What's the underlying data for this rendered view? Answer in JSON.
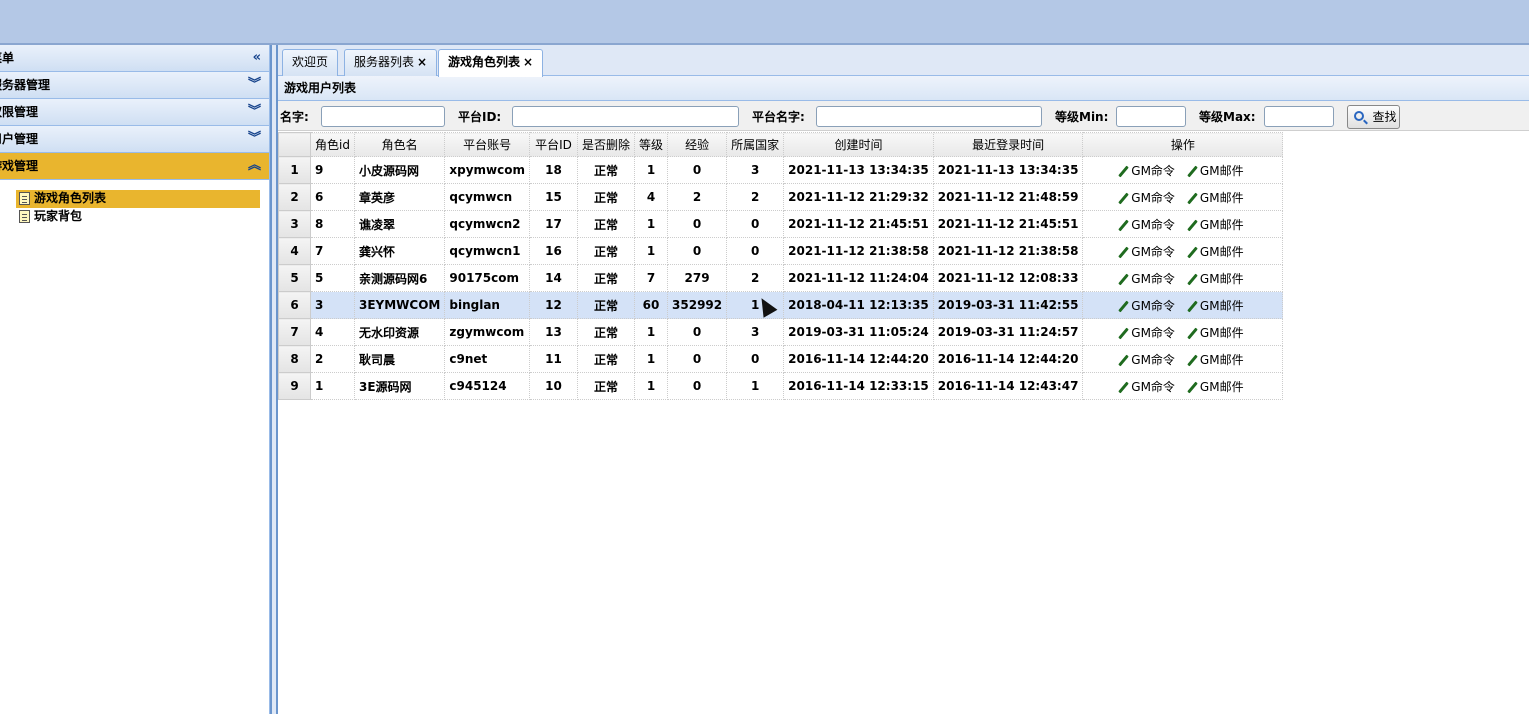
{
  "sidebar": {
    "menu_label": "菜单",
    "sections": [
      {
        "label": "服务器管理",
        "active": false
      },
      {
        "label": "权限管理",
        "active": false
      },
      {
        "label": "用户管理",
        "active": false
      },
      {
        "label": "游戏管理",
        "active": true
      }
    ],
    "tree_items": [
      {
        "label": "游戏角色列表",
        "selected": true
      },
      {
        "label": "玩家背包",
        "selected": false
      }
    ]
  },
  "tabs": [
    {
      "label": "欢迎页",
      "closable": false,
      "active": false
    },
    {
      "label": "服务器列表",
      "closable": true,
      "active": false
    },
    {
      "label": "游戏角色列表",
      "closable": true,
      "active": true
    }
  ],
  "panel": {
    "title": "游戏用户列表"
  },
  "filter": {
    "name_label": "名字:",
    "platform_id_label": "平台ID:",
    "platform_name_label": "平台名字:",
    "level_min_label": "等级Min:",
    "level_max_label": "等级Max:",
    "search_label": "查找"
  },
  "table": {
    "columns": [
      "角色id",
      "角色名",
      "平台账号",
      "平台ID",
      "是否删除",
      "等级",
      "经验",
      "所属国家",
      "创建时间",
      "最近登录时间",
      "操作"
    ],
    "actions": [
      "GM命令",
      "GM邮件"
    ],
    "rows": [
      {
        "rn": "1",
        "id": "9",
        "name": "小皮源码网",
        "account": "xpymwcom",
        "pid": "18",
        "deleted": "正常",
        "level": "1",
        "exp": "0",
        "country": "3",
        "created": "2021-11-13 13:34:35",
        "login": "2021-11-13 13:34:35"
      },
      {
        "rn": "2",
        "id": "6",
        "name": "章英彦",
        "account": "qcymwcn",
        "pid": "15",
        "deleted": "正常",
        "level": "4",
        "exp": "2",
        "country": "2",
        "created": "2021-11-12 21:29:32",
        "login": "2021-11-12 21:48:59"
      },
      {
        "rn": "3",
        "id": "8",
        "name": "谯凌翠",
        "account": "qcymwcn2",
        "pid": "17",
        "deleted": "正常",
        "level": "1",
        "exp": "0",
        "country": "0",
        "created": "2021-11-12 21:45:51",
        "login": "2021-11-12 21:45:51"
      },
      {
        "rn": "4",
        "id": "7",
        "name": "龚兴怀",
        "account": "qcymwcn1",
        "pid": "16",
        "deleted": "正常",
        "level": "1",
        "exp": "0",
        "country": "0",
        "created": "2021-11-12 21:38:58",
        "login": "2021-11-12 21:38:58"
      },
      {
        "rn": "5",
        "id": "5",
        "name": "亲测源码网6",
        "account": "90175com",
        "pid": "14",
        "deleted": "正常",
        "level": "7",
        "exp": "279",
        "country": "2",
        "created": "2021-11-12 11:24:04",
        "login": "2021-11-12 12:08:33"
      },
      {
        "rn": "6",
        "id": "3",
        "name": "3EYMWCOM",
        "account": "binglan",
        "pid": "12",
        "deleted": "正常",
        "level": "60",
        "exp": "352992",
        "country": "1",
        "created": "2018-04-11 12:13:35",
        "login": "2019-03-31 11:42:55",
        "selected": true
      },
      {
        "rn": "7",
        "id": "4",
        "name": "无水印资源",
        "account": "zgymwcom",
        "pid": "13",
        "deleted": "正常",
        "level": "1",
        "exp": "0",
        "country": "3",
        "created": "2019-03-31 11:05:24",
        "login": "2019-03-31 11:24:57"
      },
      {
        "rn": "8",
        "id": "2",
        "name": "耿司晨",
        "account": "c9net",
        "pid": "11",
        "deleted": "正常",
        "level": "1",
        "exp": "0",
        "country": "0",
        "created": "2016-11-14 12:44:20",
        "login": "2016-11-14 12:44:20"
      },
      {
        "rn": "9",
        "id": "1",
        "name": "3E源码网",
        "account": "c945124",
        "pid": "10",
        "deleted": "正常",
        "level": "1",
        "exp": "0",
        "country": "1",
        "created": "2016-11-14 12:33:15",
        "login": "2016-11-14 12:43:47"
      }
    ]
  }
}
